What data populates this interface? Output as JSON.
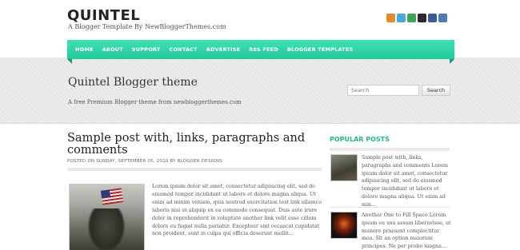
{
  "header": {
    "title": "QUINTEL",
    "description": "A Blogger Template By NewBloggerThemes.com"
  },
  "social_icons": [
    {
      "name": "rss-icon",
      "color": "#e8892a"
    },
    {
      "name": "twitter-icon",
      "color": "#4aa8dd"
    },
    {
      "name": "stumbleupon-icon",
      "color": "#3ea456"
    },
    {
      "name": "delicious-icon",
      "color": "#2a2a2a"
    },
    {
      "name": "facebook-icon",
      "color": "#3b5b9a"
    },
    {
      "name": "digg-icon",
      "color": "#4c7cb3"
    }
  ],
  "nav": {
    "items": [
      "HOME",
      "ABOUT",
      "SUPPORT",
      "CONTACT",
      "ADVERTISE",
      "RSS FEED",
      "BLOGGER TEMPLATES"
    ]
  },
  "band": {
    "title": "Quintel Blogger theme",
    "subtitle": "A free Premium Blogger theme from newbloggerthemes.com"
  },
  "search": {
    "placeholder": "Search",
    "button_label": "Search"
  },
  "post": {
    "title": "Sample post with, links, paragraphs and comments",
    "meta": "POSTED ON SUNDAY, SEPTEMBER 05, 2010 BY BLOGGER DESIGNS",
    "excerpt": "Lorem ipsum dolor sit amet, consectetur adipisicing elit, sed do eiusmod tempor incididunt ut labore et dolore magna aliqua. Ut enim ad minim veniam, quis nostrud exercitation test link ullamco laboris nisi ut aliquip ex ea commodo consequat. Duis aute irure dolor in reprehenderit in voluptate another link velit esse cillum dolore eu fugiat nulla pariatur. Excepteur sint occaecat cupidatat non proident, sunt in culpa qui officia deserunt mollit..."
  },
  "sidebar": {
    "title": "POPULAR POSTS",
    "items": [
      {
        "text": "Sample post with, links, paragraphs and comments Lorem ipsum dolor sit amet, consectetur adipisicing elit, sed do eiusmod tempor incididunt ut labore et dolore magna aliqua. Ut enim ad min..."
      },
      {
        "text": "Another One to Fill Space Lorem ipsum eu usu assum liberavisse, ut munere praesent complectitur mea. Sit an option maiorum principes. Ne per probo magna..."
      }
    ]
  },
  "colors": {
    "accent": "#24c99a",
    "accent_dark": "#159a76"
  }
}
